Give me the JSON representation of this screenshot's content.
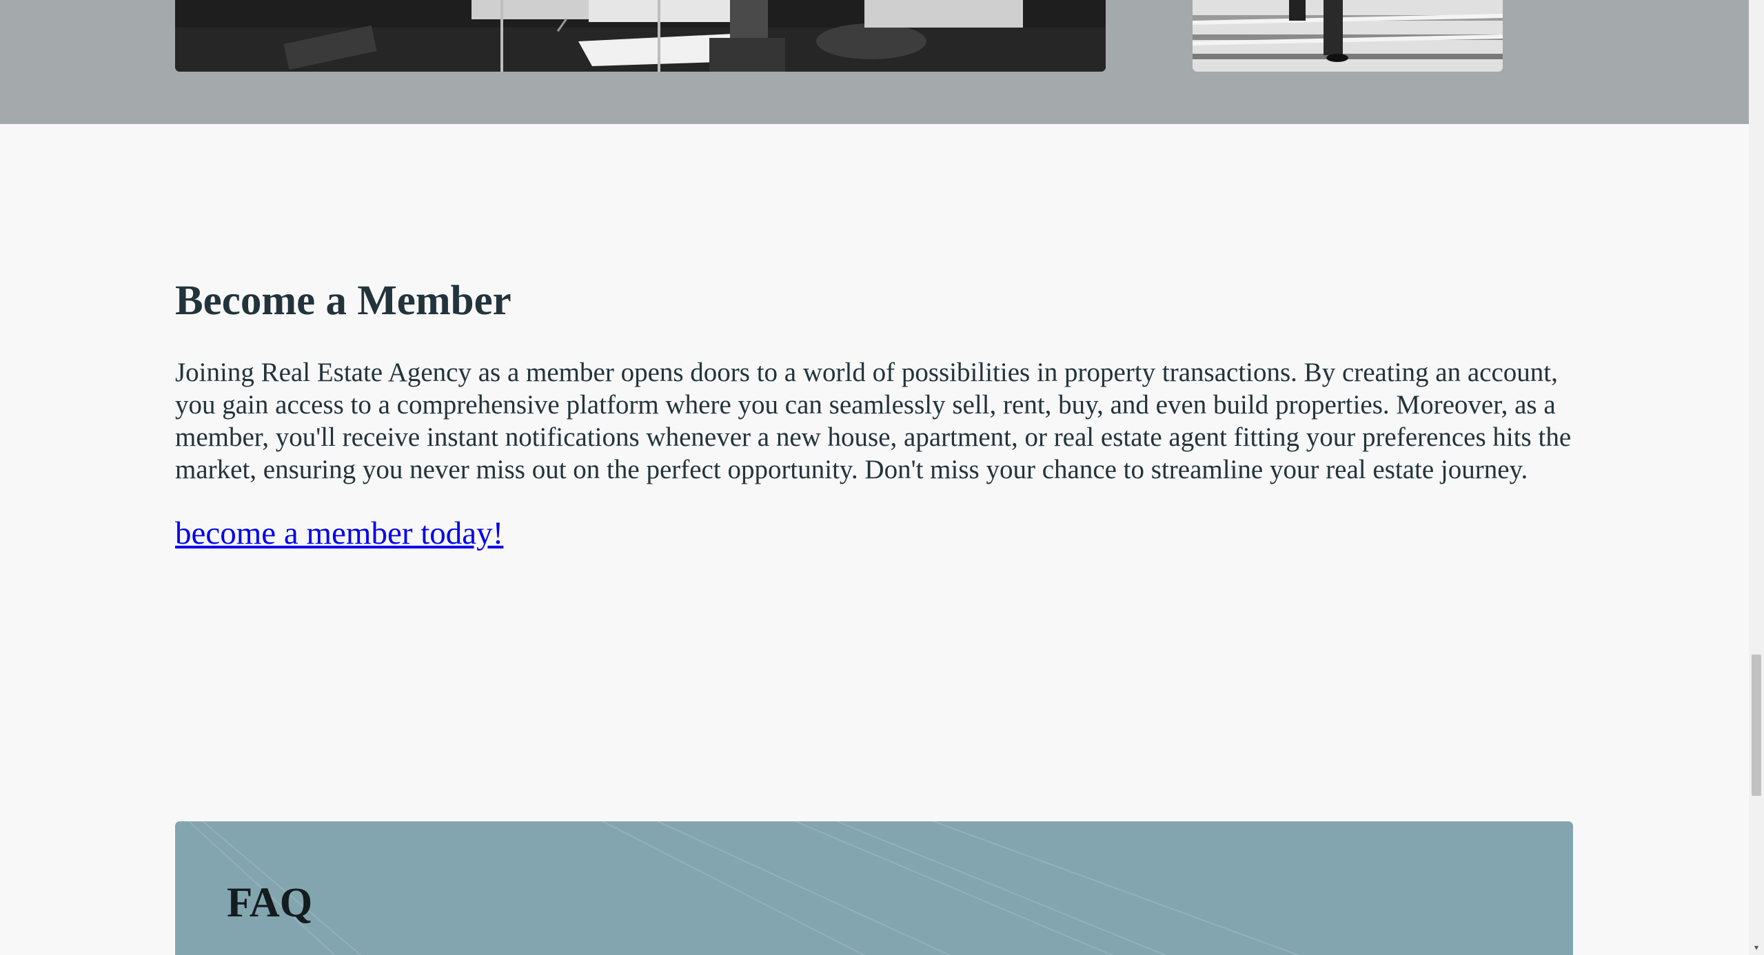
{
  "member": {
    "title": "Become a Member",
    "description": "Joining Real Estate Agency as a member opens doors to a world of possibilities in property transactions. By creating an account, you gain access to a comprehensive platform where you can seamlessly sell, rent, buy, and even build properties. Moreover, as a member, you'll receive instant notifications whenever a new house, apartment, or real estate agent fitting your preferences hits the market, ensuring you never miss out on the perfect opportunity. Don't miss your chance to streamline your real estate journey.",
    "link_label": "become a member today!"
  },
  "faq": {
    "title": "FAQ"
  },
  "scrollbar": {
    "down_arrow_icon": "chevron-down-icon"
  },
  "colors": {
    "heading": "#22333b",
    "link": "#0000ee",
    "gallery_band": "#a4a9ac",
    "faq_background": "#83a5af",
    "page_background": "#f8f8f8"
  }
}
